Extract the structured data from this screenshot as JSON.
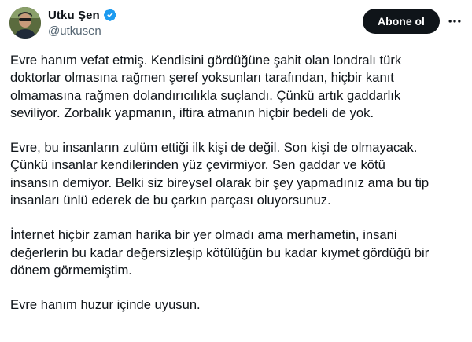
{
  "author": {
    "name": "Utku Şen",
    "handle": "@utkusen",
    "avatar_icon": "avatar-photo",
    "verified_icon": "verified-badge-icon",
    "verified_color": "#1d9bf0"
  },
  "actions": {
    "follow_label": "Abone ol",
    "more_icon": "more-icon"
  },
  "tweet": {
    "paragraphs": [
      {
        "lines": [
          "Evre hanım vefat etmiş. Kendisini gördüğüne şahit olan londralı türk",
          "doktorlar olmasına rağmen şeref yoksunları tarafından, hiçbir kanıt",
          "olmamasına rağmen dolandırıcılıkla suçlandı. Çünkü artık gaddarlık",
          "seviliyor. Zorbalık yapmanın, iftira atmanın hiçbir bedeli de yok."
        ]
      },
      {
        "lines": [
          "Evre, bu insanların zulüm ettiği ilk kişi de değil. Son kişi de olmayacak.",
          "Çünkü insanlar kendilerinden yüz çevirmiyor. Sen gaddar ve kötü",
          "insansın demiyor. Belki siz bireysel olarak bir şey yapmadınız ama bu tip",
          "insanları ünlü ederek de bu çarkın parçası oluyorsunuz."
        ]
      },
      {
        "lines": [
          "İnternet hiçbir zaman harika bir yer olmadı ama merhametin, insani",
          "değerlerin bu kadar değersizleşip kötülüğün bu kadar kıymet gördüğü bir",
          "dönem görmemiştim."
        ]
      },
      {
        "lines": [
          "Evre hanım huzur içinde uyusun."
        ]
      }
    ]
  }
}
